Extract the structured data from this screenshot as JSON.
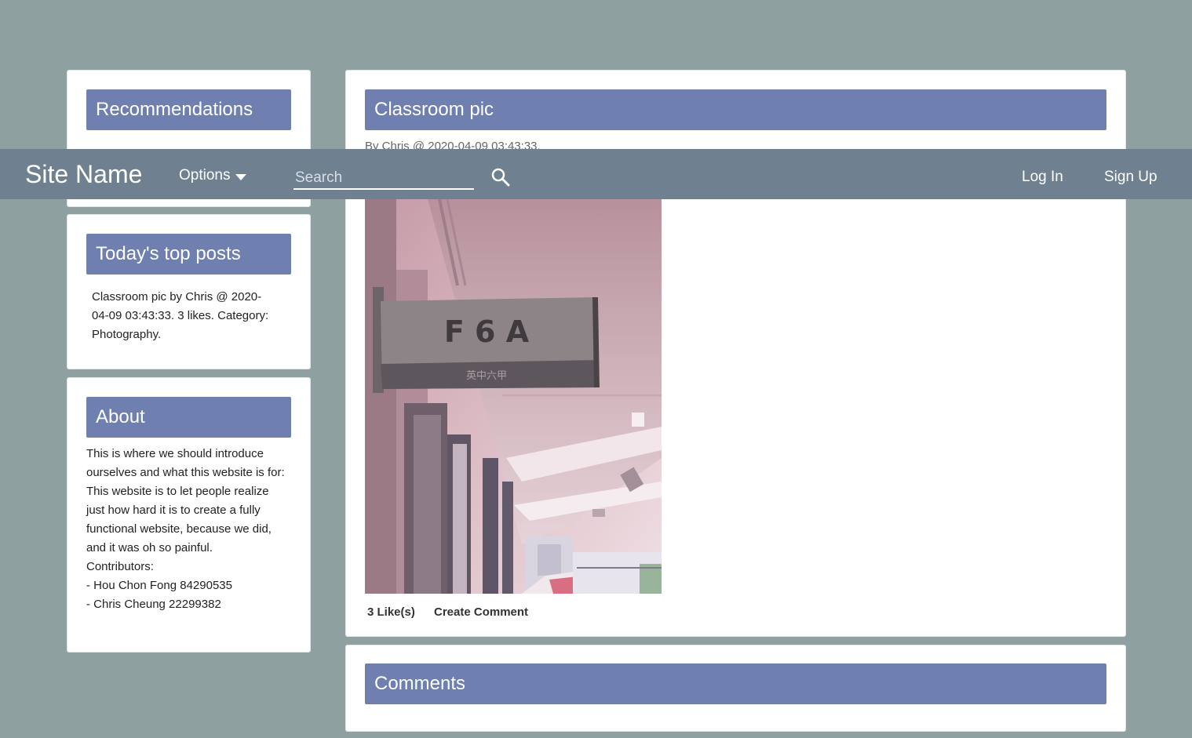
{
  "navbar": {
    "site_name": "Site Name",
    "options_label": "Options",
    "search_placeholder": "Search",
    "login_label": "Log In",
    "signup_label": "Sign Up",
    "icons": {
      "options": "caret-down-icon",
      "search": "search-icon"
    }
  },
  "sidebar": {
    "recommendations": {
      "title": "Recommendations"
    },
    "top_posts": {
      "title": "Today's top posts",
      "items": [
        "Classroom pic by Chris @ 2020-04-09 03:43:33. 3 likes. Category: Photography."
      ]
    },
    "about": {
      "title": "About",
      "lines": [
        "This is where we should introduce ourselves and what this website is for:",
        "This website is to let people realize just how hard it is to create a fully functional website, because we did, and it was oh so painful.",
        "Contributors:",
        "- Hou Chon Fong 84290535",
        "- Chris Cheung 22299382"
      ]
    }
  },
  "post": {
    "title": "Classroom pic",
    "meta": "By Chris @ 2020-04-09 03:43:33.",
    "image": {
      "sign_text": "F 6 A",
      "sign_subtext": "英中六甲"
    },
    "likes_label": "3 Like(s)",
    "create_comment_label": "Create Comment"
  },
  "comments": {
    "title": "Comments"
  },
  "colors": {
    "background": "#8fa0a0",
    "navbar": "#6f8090",
    "card_header": "#6e7fb0",
    "card": "#ffffff"
  }
}
